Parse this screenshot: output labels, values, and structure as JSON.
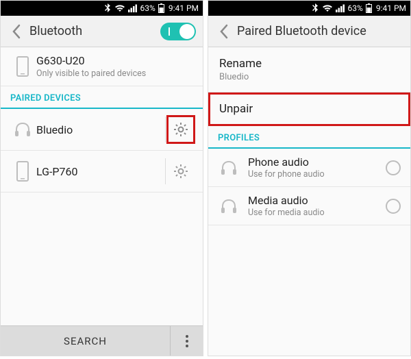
{
  "status": {
    "battery_pct": "63%",
    "time": "9:41 PM"
  },
  "left": {
    "title": "Bluetooth",
    "self": {
      "name": "G630-U20",
      "hint": "Only visible to paired devices"
    },
    "section_paired": "PAIRED DEVICES",
    "devices": [
      {
        "name": "Bluedio"
      },
      {
        "name": "LG-P760"
      }
    ],
    "search_label": "SEARCH"
  },
  "right": {
    "title": "Paired Bluetooth device",
    "rename_label": "Rename",
    "rename_value": "Bluedio",
    "unpair_label": "Unpair",
    "section_profiles": "PROFILES",
    "profiles": [
      {
        "title": "Phone audio",
        "sub": "Use for phone audio"
      },
      {
        "title": "Media audio",
        "sub": "Use for media audio"
      }
    ]
  }
}
